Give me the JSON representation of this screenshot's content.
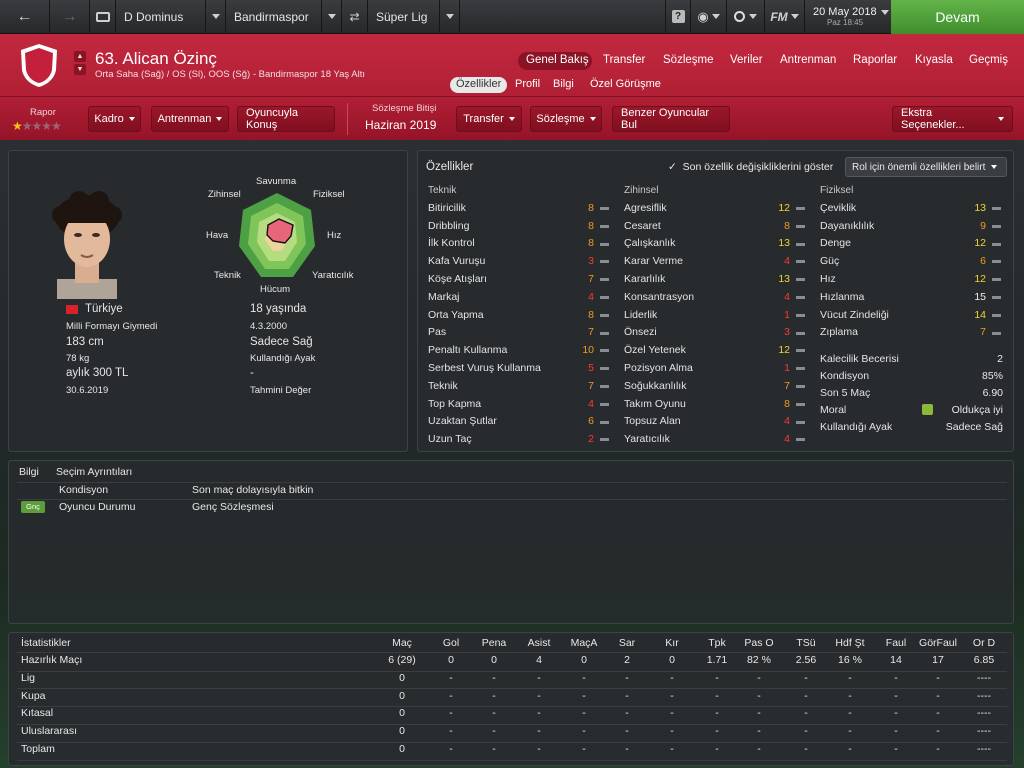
{
  "topbar": {
    "manager": "D Dominus",
    "club": "Bandirmaspor",
    "league": "Süper Lig",
    "date": "20 May 2018",
    "time": "Paz 18:45",
    "continue": "Devam",
    "fm": "FM"
  },
  "header": {
    "player_title": "63. Alican Özinç",
    "subtitle": "Orta Saha (Sağ) / OS (Sl), OOS (Sğ) - Bandirmaspor 18 Yaş Altı",
    "nav": [
      "Genel Bakış",
      "Transfer",
      "Sözleşme",
      "Veriler",
      "Antrenman",
      "Raporlar",
      "Kıyasla",
      "Geçmiş"
    ],
    "subnav": [
      "Özellikler",
      "Profil",
      "Bilgi",
      "Özel Görüşme"
    ],
    "report_label": "Rapor",
    "contract_label": "Sözleşme Bitişi",
    "contract_value": "Haziran 2019",
    "buttons": {
      "squad": "Kadro",
      "training": "Antrenman",
      "talk": "Oyuncuyla Konuş",
      "transfer": "Transfer",
      "contract": "Sözleşme",
      "similar": "Benzer Oyuncular Bul",
      "extra": "Ekstra Seçenekler..."
    },
    "star_rating": 1,
    "star_max": 5
  },
  "profile": {
    "nationality": "Türkiye",
    "intl": "Milli Formayı Giymedi",
    "height": "183 cm",
    "weight": "78 kg",
    "wage": "aylık 300 TL",
    "contract_end": "30.6.2019",
    "age": "18 yaşında",
    "dob": "4.3.2000",
    "foot": "Sadece Sağ",
    "foot_label": "Kullandığı Ayak",
    "value": "-",
    "value_label": "Tahmini Değer",
    "radar_labels": {
      "top": "Savunma",
      "top_left": "Zihinsel",
      "top_right": "Fiziksel",
      "left": "Hava",
      "right": "Hız",
      "bottom_left": "Teknik",
      "bottom_right": "Yaratıcılık",
      "bottom": "Hücum"
    }
  },
  "attributes": {
    "title": "Özellikler",
    "checkbox_label": "Son özellik değişikliklerini göster",
    "role_select": "Rol için önemli özellikleri belirt",
    "technical_title": "Teknik",
    "mental_title": "Zihinsel",
    "physical_title": "Fiziksel",
    "technical": [
      [
        "Bitiricilik",
        "8"
      ],
      [
        "Dribbling",
        "8"
      ],
      [
        "İlk Kontrol",
        "8"
      ],
      [
        "Kafa Vuruşu",
        "3"
      ],
      [
        "Köşe Atışları",
        "7"
      ],
      [
        "Markaj",
        "4"
      ],
      [
        "Orta Yapma",
        "8"
      ],
      [
        "Pas",
        "7"
      ],
      [
        "Penaltı Kullanma",
        "10"
      ],
      [
        "Serbest Vuruş Kullanma",
        "5"
      ],
      [
        "Teknik",
        "7"
      ],
      [
        "Top Kapma",
        "4"
      ],
      [
        "Uzaktan Şutlar",
        "6"
      ],
      [
        "Uzun Taç",
        "2"
      ]
    ],
    "mental": [
      [
        "Agresiflik",
        "12"
      ],
      [
        "Cesaret",
        "8"
      ],
      [
        "Çalışkanlık",
        "13"
      ],
      [
        "Karar Verme",
        "4"
      ],
      [
        "Kararlılık",
        "13"
      ],
      [
        "Konsantrasyon",
        "4"
      ],
      [
        "Liderlik",
        "1"
      ],
      [
        "Önsezi",
        "3"
      ],
      [
        "Özel Yetenek",
        "12"
      ],
      [
        "Pozisyon Alma",
        "1"
      ],
      [
        "Soğukkanlılık",
        "7"
      ],
      [
        "Takım Oyunu",
        "8"
      ],
      [
        "Topsuz Alan",
        "4"
      ],
      [
        "Yaratıcılık",
        "4"
      ]
    ],
    "physical": [
      [
        "Çeviklik",
        "13"
      ],
      [
        "Dayanıklılık",
        "9"
      ],
      [
        "Denge",
        "12"
      ],
      [
        "Güç",
        "6"
      ],
      [
        "Hız",
        "12"
      ],
      [
        "Hızlanma",
        "15"
      ],
      [
        "Vücut Zindeliği",
        "14"
      ],
      [
        "Zıplama",
        "7"
      ]
    ],
    "extra": [
      [
        "Kalecilik Becerisi",
        "2"
      ],
      [
        "Kondisyon",
        "85%"
      ],
      [
        "Son 5 Maç",
        "6.90"
      ],
      [
        "Moral",
        "Oldukça iyi"
      ],
      [
        "Kullandığı Ayak",
        "Sadece Sağ"
      ]
    ]
  },
  "selection": {
    "bilgi": "Bilgi",
    "title": "Seçim Ayrıntıları",
    "rows": [
      {
        "badge": "",
        "label": "Kondisyon",
        "value": "Son maç dolayısıyla bitkin"
      },
      {
        "badge": "Gnç",
        "label": "Oyuncu Durumu",
        "value": "Genç Sözleşmesi"
      }
    ]
  },
  "stats": {
    "headers": [
      "İstatistikler",
      "Maç",
      "Gol",
      "Pena",
      "Asist",
      "MaçA",
      "Sar",
      "Kır",
      "Tpk",
      "Pas O",
      "TSü",
      "Hdf Şt",
      "Faul",
      "GörFaul",
      "Or D"
    ],
    "rows": [
      [
        "Hazırlık Maçı",
        "6 (29)",
        "0",
        "0",
        "4",
        "0",
        "2",
        "0",
        "1.71",
        "82 %",
        "2.56",
        "16 %",
        "14",
        "17",
        "6.85"
      ],
      [
        "Lig",
        "0",
        "-",
        "-",
        "-",
        "-",
        "-",
        "-",
        "-",
        "-",
        "-",
        "-",
        "-",
        "-",
        "----"
      ],
      [
        "Kupa",
        "0",
        "-",
        "-",
        "-",
        "-",
        "-",
        "-",
        "-",
        "-",
        "-",
        "-",
        "-",
        "-",
        "----"
      ],
      [
        "Kıtasal",
        "0",
        "-",
        "-",
        "-",
        "-",
        "-",
        "-",
        "-",
        "-",
        "-",
        "-",
        "-",
        "-",
        "----"
      ],
      [
        "Uluslararası",
        "0",
        "-",
        "-",
        "-",
        "-",
        "-",
        "-",
        "-",
        "-",
        "-",
        "-",
        "-",
        "-",
        "----"
      ],
      [
        "Toplam",
        "0",
        "-",
        "-",
        "-",
        "-",
        "-",
        "-",
        "-",
        "-",
        "-",
        "-",
        "-",
        "-",
        "----"
      ]
    ]
  }
}
